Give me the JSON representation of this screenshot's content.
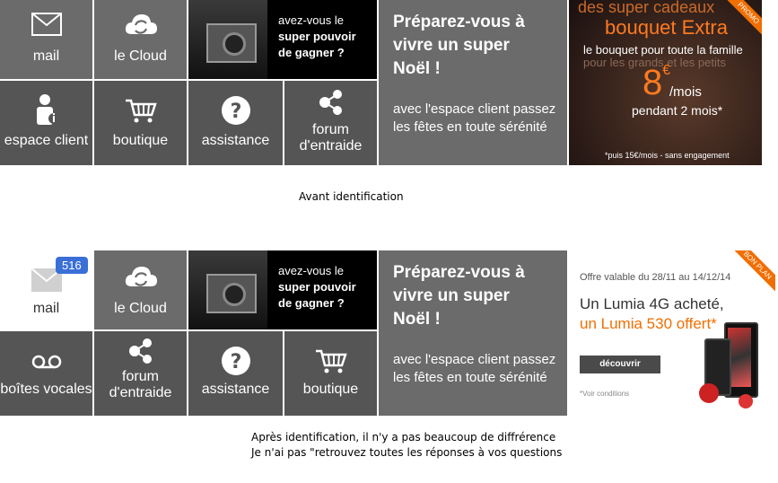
{
  "top": {
    "tiles": {
      "mail": "mail",
      "cloud": "le Cloud",
      "espace_client": "espace client",
      "boutique": "boutique",
      "assistance": "assistance",
      "forum": "forum d'entraide"
    },
    "promo_text_1": "avez-vous le",
    "promo_text_2": "super pouvoir",
    "promo_text_3": "de gagner ?",
    "noel_title": "Préparez-vous à vivre un super Noël !",
    "noel_body": "avec l'espace client passez les fêtes en toute sérénité",
    "ad": {
      "headline_1": "des super cadeaux",
      "headline_2": "bouquet Extra",
      "line_1": "le bouquet pour toute la famille",
      "line_2": "pour les grands et les petits",
      "price": "8",
      "currency": "€",
      "per": "/mois",
      "duration": "pendant 2 mois*",
      "footnote": "*puis 15€/mois - sans engagement",
      "badge": "PROMO"
    }
  },
  "caption_before": "Avant identification",
  "bottom": {
    "tiles": {
      "mail": "mail",
      "mail_count": "516",
      "cloud": "le Cloud",
      "voicemail": "boîtes vocales",
      "forum": "forum d'entraide",
      "assistance": "assistance",
      "boutique": "boutique"
    },
    "promo_text_1": "avez-vous le",
    "promo_text_2": "super pouvoir",
    "promo_text_3": "de gagner ?",
    "noel_title": "Préparez-vous à vivre un super Noël !",
    "noel_body": "avec l'espace client passez les fêtes en toute sérénité",
    "ad": {
      "validity": "Offre valable du 28/11 au 14/12/14",
      "line_1": "Un Lumia 4G acheté,",
      "line_2": "un Lumia 530 offert*",
      "button": "découvrir",
      "conditions": "*Voir conditions",
      "badge": "BON PLAN"
    }
  },
  "caption_after_1": "Après identification, il n'y a pas beaucoup de diffrérence",
  "caption_after_2": "Je n'ai pas \"retrouvez toutes les réponses à vos questions"
}
